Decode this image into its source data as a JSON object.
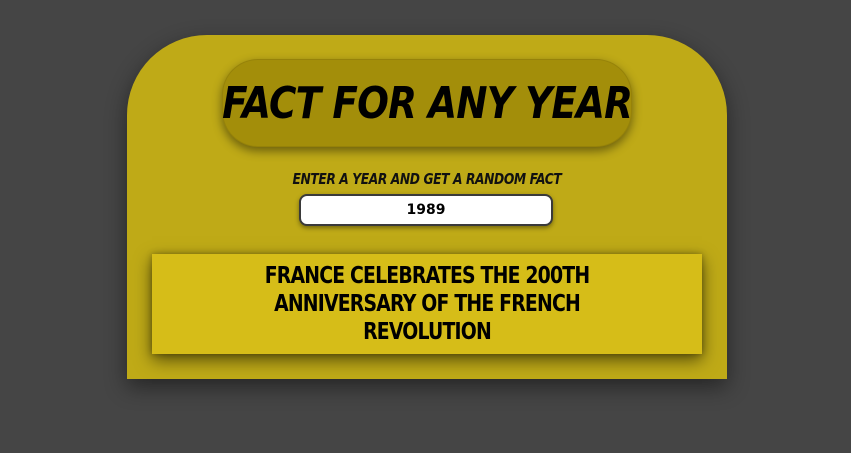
{
  "app": {
    "title": "Fact for any year",
    "subtitle": "Enter a year and get a random fact"
  },
  "form": {
    "year_value": "1989"
  },
  "fact": {
    "text": "France celebrates the 200th anniversary of the French Revolution"
  },
  "colors": {
    "background": "#454545",
    "card": "#bfaa17",
    "title_pill": "#a38e0a",
    "fact_box": "#d6bd18"
  }
}
